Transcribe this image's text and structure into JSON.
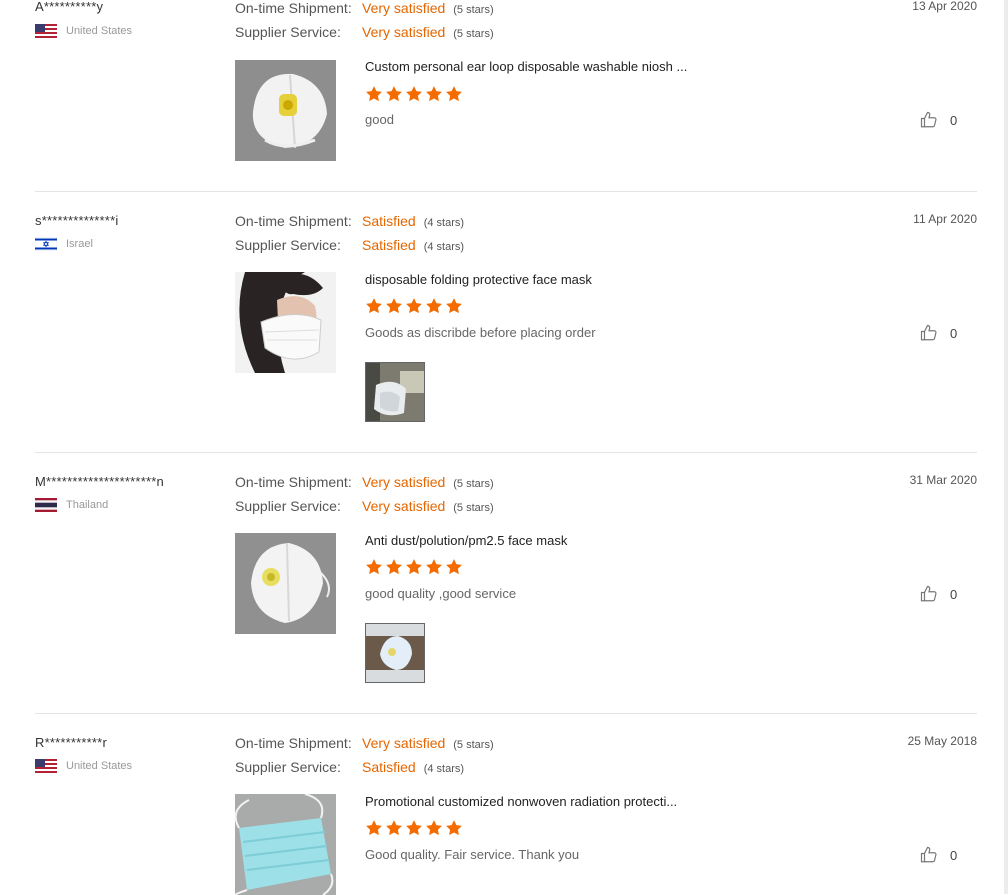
{
  "labels": {
    "shipment": "On-time Shipment:",
    "service": "Supplier Service:"
  },
  "colors": {
    "accent": "#e56600",
    "star": "#f46c00"
  },
  "reviews": [
    {
      "buyer": "A**********y",
      "country": "United States",
      "flag": "us-flag",
      "date": "13 Apr 2020",
      "shipment_value": "Very satisfied",
      "shipment_stars": "(5 stars)",
      "service_value": "Very satisfied",
      "service_stars": "(5 stars)",
      "product": "Custom personal ear loop disposable washable niosh ...",
      "rating": 5,
      "comment": "good",
      "likes": "0",
      "photo": false
    },
    {
      "buyer": "s**************i",
      "country": "Israel",
      "flag": "il-flag",
      "date": "11 Apr 2020",
      "shipment_value": "Satisfied",
      "shipment_stars": "(4 stars)",
      "service_value": "Satisfied",
      "service_stars": "(4 stars)",
      "product": "disposable folding protective face mask",
      "rating": 5,
      "comment": "Goods as discribde before placing order",
      "likes": "0",
      "photo": true
    },
    {
      "buyer": "M*********************n",
      "country": "Thailand",
      "flag": "th-flag",
      "date": "31 Mar 2020",
      "shipment_value": "Very satisfied",
      "shipment_stars": "(5 stars)",
      "service_value": "Very satisfied",
      "service_stars": "(5 stars)",
      "product": "Anti dust/polution/pm2.5 face mask",
      "rating": 5,
      "comment": "good quality ,good service",
      "likes": "0",
      "photo": true
    },
    {
      "buyer": "R***********r",
      "country": "United States",
      "flag": "us-flag",
      "date": "25 May 2018",
      "shipment_value": "Very satisfied",
      "shipment_stars": "(5 stars)",
      "service_value": "Satisfied",
      "service_stars": "(4 stars)",
      "product": "Promotional customized nonwoven radiation protecti...",
      "rating": 5,
      "comment": "Good quality. Fair service. Thank you",
      "likes": "0",
      "photo": false
    }
  ]
}
